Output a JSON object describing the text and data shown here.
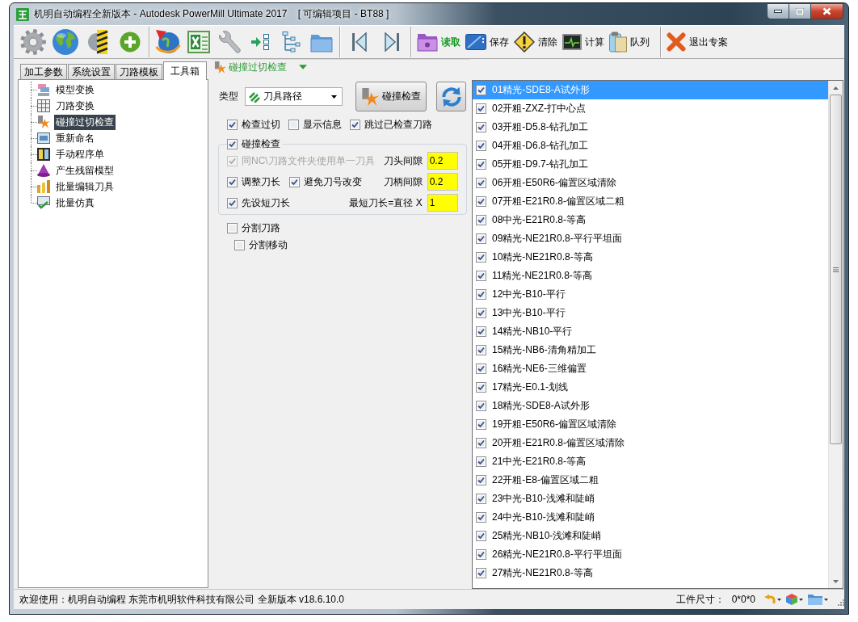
{
  "window": {
    "title": "机明自动编程全新版本 - Autodesk PowerMill Ultimate 2017    [ 可编辑项目 - BT88 ]"
  },
  "toolbar": {
    "labeled_groups": [
      [
        {
          "label": "读取",
          "highlighted": true
        },
        {
          "label": "保存",
          "highlighted": false
        },
        {
          "label": "清除",
          "highlighted": false
        },
        {
          "label": "计算",
          "highlighted": false
        },
        {
          "label": "队列",
          "highlighted": false
        }
      ],
      [
        {
          "label": "退出专案",
          "highlighted": false
        }
      ]
    ]
  },
  "left_tabs": [
    {
      "label": "加工参数",
      "selected": false
    },
    {
      "label": "系统设置",
      "selected": false
    },
    {
      "label": "刀路模板",
      "selected": false
    },
    {
      "label": "工具箱",
      "selected": true
    }
  ],
  "tool_tree": [
    {
      "label": "模型变换",
      "selected": false
    },
    {
      "label": "刀路变换",
      "selected": false
    },
    {
      "label": "碰撞过切检查",
      "selected": true
    },
    {
      "label": "重新命名",
      "selected": false
    },
    {
      "label": "手动程序单",
      "selected": false
    },
    {
      "label": "产生残留模型",
      "selected": false
    },
    {
      "label": "批量编辑刀具",
      "selected": false
    },
    {
      "label": "批量仿真",
      "selected": false
    }
  ],
  "collision_panel": {
    "title": "碰撞过切检查",
    "type_label": "类型",
    "type_value": "刀具路径",
    "check_button": "碰撞检查",
    "options": [
      {
        "label": "检查过切",
        "checked": true
      },
      {
        "label": "显示信息",
        "checked": false
      },
      {
        "label": "跳过已检查刀路",
        "checked": true
      }
    ],
    "group": {
      "label": "碰撞检查",
      "checked": true,
      "rows": [
        {
          "checkboxes": [
            {
              "label": "同NC\\刀路文件夹使用单一刀具",
              "checked": true,
              "disabled": true
            }
          ],
          "field": {
            "label": "刀头间隙",
            "value": "0.2"
          }
        },
        {
          "checkboxes": [
            {
              "label": "调整刀长",
              "checked": true,
              "disabled": false
            },
            {
              "label": "避免刀号改变",
              "checked": true,
              "disabled": false
            }
          ],
          "field": {
            "label": "刀柄间隙",
            "value": "0.2"
          }
        },
        {
          "checkboxes": [
            {
              "label": "先设短刀长",
              "checked": true,
              "disabled": false
            }
          ],
          "field": {
            "label": "最短刀长=直径 X",
            "value": "1"
          }
        }
      ]
    },
    "split_options": [
      {
        "label": "分割刀路",
        "checked": false,
        "children": [
          {
            "label": "分割移动",
            "checked": false
          }
        ]
      }
    ]
  },
  "toolpath_list": [
    {
      "label": "01精光-SDE8-A试外形",
      "checked": true,
      "selected": true
    },
    {
      "label": "02开粗-ZXZ-打中心点",
      "checked": true,
      "selected": false
    },
    {
      "label": "03开粗-D5.8-钻孔加工",
      "checked": true,
      "selected": false
    },
    {
      "label": "04开粗-D6.8-钻孔加工",
      "checked": true,
      "selected": false
    },
    {
      "label": "05开粗-D9.7-钻孔加工",
      "checked": true,
      "selected": false
    },
    {
      "label": "06开粗-E50R6-偏置区域清除",
      "checked": true,
      "selected": false
    },
    {
      "label": "07开粗-E21R0.8-偏置区域二粗",
      "checked": true,
      "selected": false
    },
    {
      "label": "08中光-E21R0.8-等高",
      "checked": true,
      "selected": false
    },
    {
      "label": "09精光-NE21R0.8-平行平坦面",
      "checked": true,
      "selected": false
    },
    {
      "label": "10精光-NE21R0.8-等高",
      "checked": true,
      "selected": false
    },
    {
      "label": "11精光-NE21R0.8-等高",
      "checked": true,
      "selected": false
    },
    {
      "label": "12中光-B10-平行",
      "checked": true,
      "selected": false
    },
    {
      "label": "13中光-B10-平行",
      "checked": true,
      "selected": false
    },
    {
      "label": "14精光-NB10-平行",
      "checked": true,
      "selected": false
    },
    {
      "label": "15精光-NB6-清角精加工",
      "checked": true,
      "selected": false
    },
    {
      "label": "16精光-NE6-三维偏置",
      "checked": true,
      "selected": false
    },
    {
      "label": "17精光-E0.1-划线",
      "checked": true,
      "selected": false
    },
    {
      "label": "18精光-SDE8-A试外形",
      "checked": true,
      "selected": false
    },
    {
      "label": "19开粗-E50R6-偏置区域清除",
      "checked": true,
      "selected": false
    },
    {
      "label": "20开粗-E21R0.8-偏置区域清除",
      "checked": true,
      "selected": false
    },
    {
      "label": "21中光-E21R0.8-等高",
      "checked": true,
      "selected": false
    },
    {
      "label": "22开粗-E8-偏置区域二粗",
      "checked": true,
      "selected": false
    },
    {
      "label": "23中光-B10-浅滩和陡峭",
      "checked": true,
      "selected": false
    },
    {
      "label": "24中光-B10-浅滩和陡峭",
      "checked": true,
      "selected": false
    },
    {
      "label": "25精光-NB10-浅滩和陡峭",
      "checked": true,
      "selected": false
    },
    {
      "label": "26精光-NE21R0.8-平行平坦面",
      "checked": true,
      "selected": false
    },
    {
      "label": "27精光-NE21R0.8-等高",
      "checked": true,
      "selected": false
    }
  ],
  "status_bar": {
    "message": "欢迎使用：机明自动编程 东莞市机明软件科技有限公司 全新版本 v18.6.10.0",
    "part_size_label": "工件尺寸：",
    "part_size_value": "0*0*0"
  }
}
